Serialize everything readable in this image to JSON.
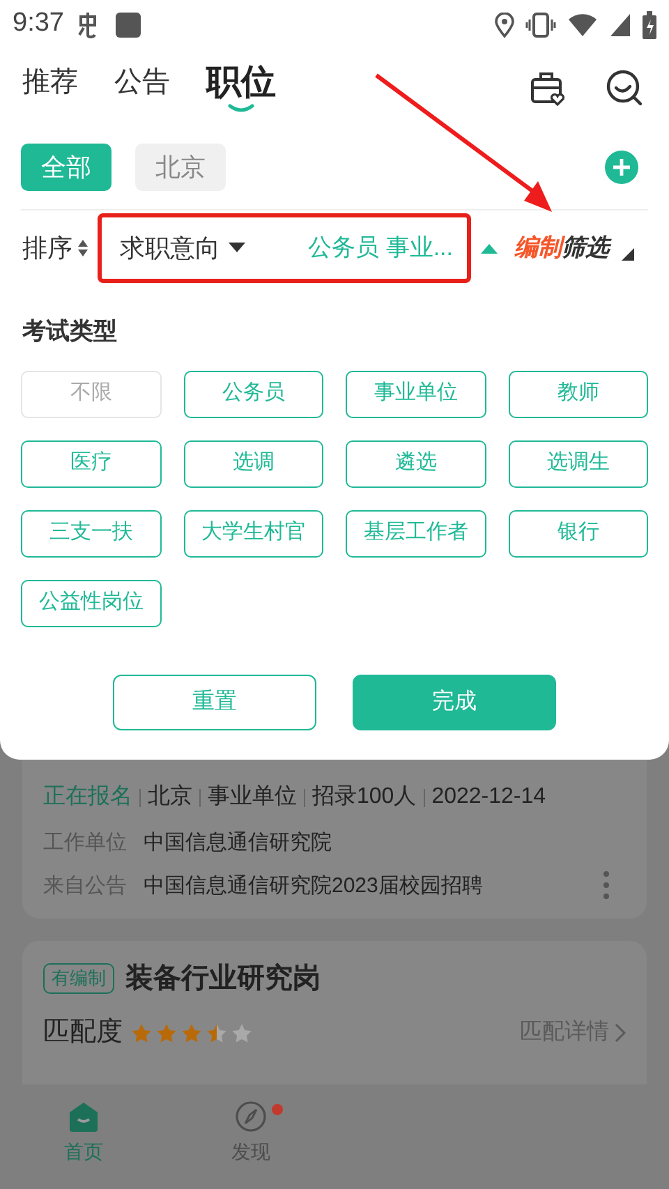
{
  "status_bar": {
    "time": "9:37"
  },
  "top_tabs": [
    {
      "label": "推荐",
      "selected": false
    },
    {
      "label": "公告",
      "selected": false
    },
    {
      "label": "职位",
      "selected": true
    }
  ],
  "chips": [
    {
      "label": "全部",
      "selected": true
    },
    {
      "label": "北京",
      "selected": false
    }
  ],
  "filter_bar": {
    "sort_label": "排序",
    "intent_label": "求职意向",
    "intent_value": "公务员 事业...",
    "edit_filter": {
      "highlight": "编制",
      "rest": "筛选"
    }
  },
  "exam_type": {
    "title": "考试类型",
    "options": [
      {
        "label": "不限",
        "selected": false
      },
      {
        "label": "公务员",
        "selected": true
      },
      {
        "label": "事业单位",
        "selected": true
      },
      {
        "label": "教师",
        "selected": true
      },
      {
        "label": "医疗",
        "selected": true
      },
      {
        "label": "选调",
        "selected": true
      },
      {
        "label": "遴选",
        "selected": true
      },
      {
        "label": "选调生",
        "selected": true
      },
      {
        "label": "三支一扶",
        "selected": true
      },
      {
        "label": "大学生村官",
        "selected": true
      },
      {
        "label": "基层工作者",
        "selected": true
      },
      {
        "label": "银行",
        "selected": true
      },
      {
        "label": "公益性岗位",
        "selected": true
      }
    ]
  },
  "actions": {
    "reset": "重置",
    "done": "完成"
  },
  "jobs": [
    {
      "status": "正在报名",
      "meta": [
        "北京",
        "事业单位",
        "招录100人",
        "2022-12-14"
      ],
      "fields": [
        {
          "label": "工作单位",
          "value": "中国信息通信研究院"
        },
        {
          "label": "来自公告",
          "value": "中国信息通信研究院2023届校园招聘"
        }
      ]
    },
    {
      "tag": "有编制",
      "title": "装备行业研究岗",
      "match_label": "匹配度",
      "stars": 3.5,
      "detail_link": "匹配详情"
    }
  ],
  "bottom_nav": [
    {
      "label": "首页",
      "selected": true,
      "badge": false
    },
    {
      "label": "发现",
      "selected": false,
      "badge": true
    }
  ]
}
